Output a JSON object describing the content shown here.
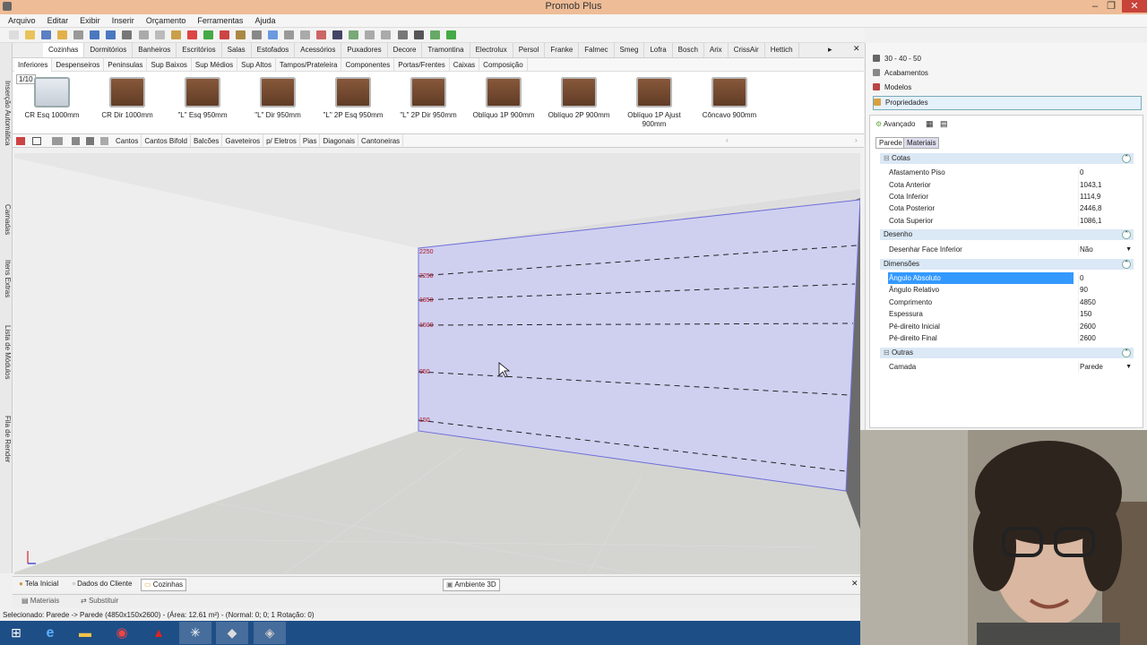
{
  "window": {
    "title": "Promob Plus"
  },
  "menu": [
    "Arquivo",
    "Editar",
    "Exibir",
    "Inserir",
    "Orçamento",
    "Ferramentas",
    "Ajuda"
  ],
  "left_tabs": [
    "Inserção Automática",
    "Camadas",
    "Itens Extras",
    "Lista de Módulos",
    "Fila de Render"
  ],
  "category_tabs": [
    "Cozinhas",
    "Dormitórios",
    "Banheiros",
    "Escritórios",
    "Salas",
    "Estofados",
    "Acessórios",
    "Puxadores",
    "Decore",
    "Tramontina",
    "Electrolux",
    "Persol",
    "Franke",
    "Falmec",
    "Smeg",
    "Lofra",
    "Bosch",
    "Arix",
    "CrissAir",
    "Hettich"
  ],
  "sub_tabs": [
    "Inferiores",
    "Despenseiros",
    "Peninsulas",
    "Sup Baixos",
    "Sup Médios",
    "Sup Altos",
    "Tampos/Prateleira",
    "Componentes",
    "Portas/Frentes",
    "Caixas",
    "Composição"
  ],
  "catalog": {
    "pager": "1/10",
    "items": [
      {
        "label": "CR Esq 1000mm"
      },
      {
        "label": "CR Dir 1000mm"
      },
      {
        "label": "\"L\" Esq 950mm"
      },
      {
        "label": "\"L\" Dir 950mm"
      },
      {
        "label": "\"L\" 2P Esq 950mm"
      },
      {
        "label": "\"L\" 2P Dir 950mm"
      },
      {
        "label": "Oblíquo 1P 900mm"
      },
      {
        "label": "Oblíquo 2P 900mm"
      },
      {
        "label": "Oblíquo 1P Ajust 900mm"
      },
      {
        "label": "Côncavo 900mm"
      }
    ]
  },
  "filter_tabs": [
    "Cantos",
    "Cantos Bifold",
    "Balcões",
    "Gaveteiros",
    "p/ Eletros",
    "Pias",
    "Diagonais",
    "Cantoneiras"
  ],
  "viewport": {
    "wall_labels": [
      "2250",
      "2250",
      "1850",
      "1500",
      "950",
      "150"
    ]
  },
  "doc_tabs": [
    "Tela Inicial",
    "Dados do Cliente",
    "Cozinhas",
    "Ambiente 3D"
  ],
  "bottom_tabs": [
    "Materiais",
    "Substituir"
  ],
  "status": "Selecionado: Parede -> Parede (4850x150x2600) - (Área: 12.61 m²) - (Normal: 0; 0; 1 Rotação: 0)",
  "right_panel": {
    "headers": [
      "30 - 40 - 50",
      "Acabamentos",
      "Modelos",
      "Propriedades"
    ],
    "prop_tabs": [
      "Parede",
      "Materiais"
    ],
    "advanced_label": "Avançado",
    "sections": [
      {
        "title": "Cotas",
        "rows": [
          {
            "label": "Afastamento Piso",
            "value": "0"
          },
          {
            "label": "Cota Anterior",
            "value": "1043,1"
          },
          {
            "label": "Cota Inferior",
            "value": "1114,9"
          },
          {
            "label": "Cota Posterior",
            "value": "2446,8"
          },
          {
            "label": "Cota Superior",
            "value": "1086,1"
          }
        ]
      },
      {
        "title": "Desenho",
        "rows": [
          {
            "label": "Desenhar Face Inferior",
            "value": "Não"
          }
        ]
      },
      {
        "title": "Dimensões",
        "rows": [
          {
            "label": "Ângulo Absoluto",
            "value": "0"
          },
          {
            "label": "Ângulo Relativo",
            "value": "90"
          },
          {
            "label": "Comprimento",
            "value": "4850"
          },
          {
            "label": "Espessura",
            "value": "150"
          },
          {
            "label": "Pé-direito Inicial",
            "value": "2600"
          },
          {
            "label": "Pé-direito Final",
            "value": "2600"
          }
        ]
      },
      {
        "title": "Outras",
        "rows": [
          {
            "label": "Camada",
            "value": "Parede"
          }
        ]
      }
    ]
  },
  "colors": {
    "title_bar": "#eebc96",
    "selection": "#3399ff",
    "wall_highlight": "#cfd0f0",
    "taskbar": "#1e4e86"
  }
}
